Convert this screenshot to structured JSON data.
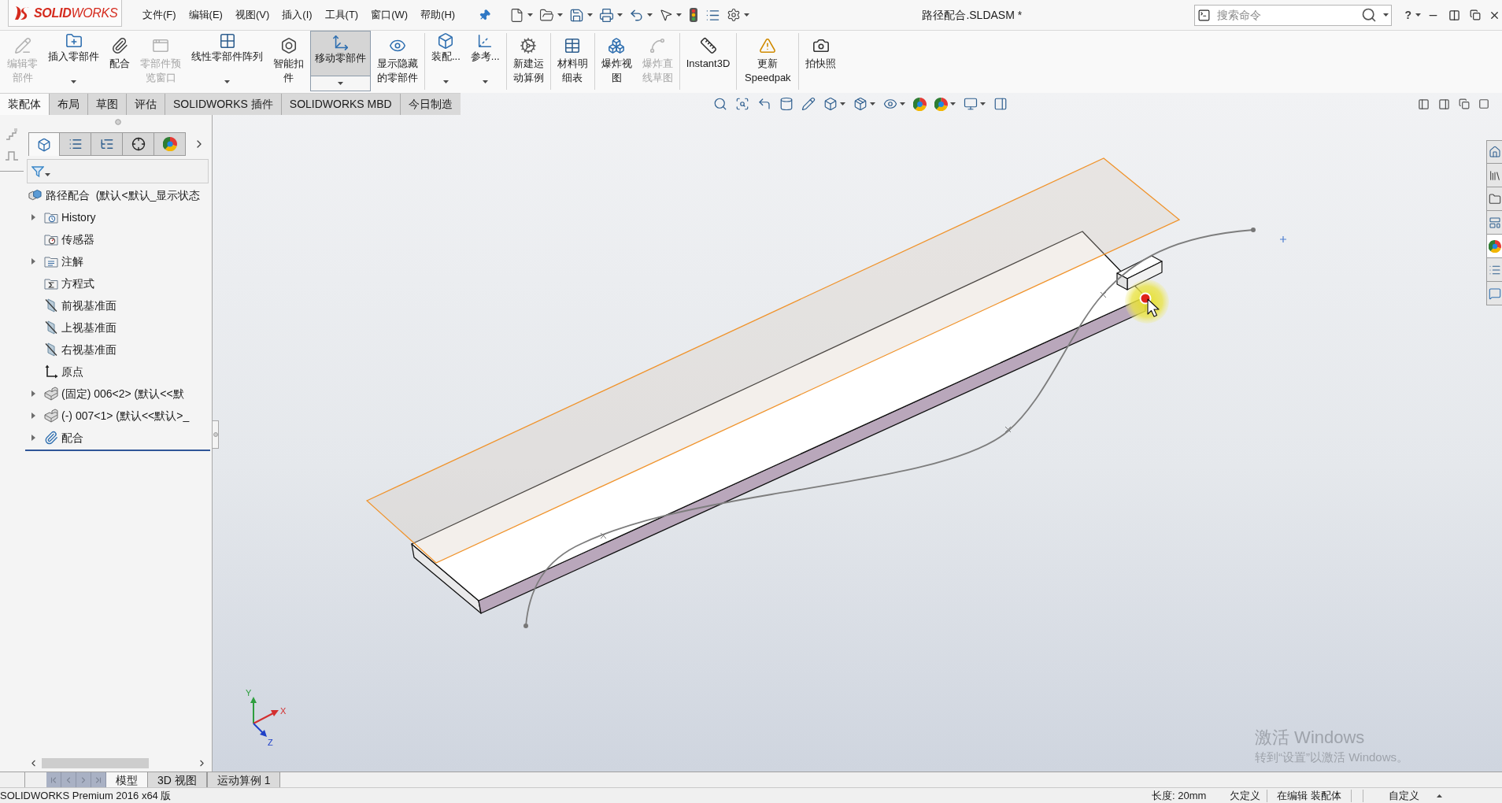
{
  "title_bar": {
    "logo": "**SOLID**WORKS",
    "menu": [
      "文件(F)",
      "编辑(E)",
      "视图(V)",
      "插入(I)",
      "工具(T)",
      "窗口(W)",
      "帮助(H)"
    ],
    "document_title": "路径配合.SLDASM *",
    "search": {
      "placeholder": "搜索命令"
    },
    "help": "?"
  },
  "ribbon": {
    "groups": [
      [
        {
          "label": "编辑零部件",
          "disabled": true,
          "dropdown": false,
          "active": false
        },
        {
          "label": "插入零部件",
          "disabled": false,
          "dropdown": true,
          "active": false
        },
        {
          "label": "配合",
          "disabled": false,
          "dropdown": false,
          "active": false
        },
        {
          "label": "零部件预览窗口",
          "disabled": true,
          "dropdown": false,
          "active": false
        },
        {
          "label": "线性零部件阵列",
          "disabled": false,
          "dropdown": true,
          "active": false
        },
        {
          "label": "智能扣件",
          "disabled": false,
          "dropdown": false,
          "active": false
        },
        {
          "label": "移动零部件",
          "disabled": false,
          "dropdown": true,
          "active": true
        },
        {
          "label": "显示隐藏的零部件",
          "disabled": false,
          "dropdown": false,
          "active": false
        }
      ],
      [
        {
          "label": "装配...",
          "disabled": false,
          "dropdown": true,
          "active": false
        },
        {
          "label": "参考...",
          "disabled": false,
          "dropdown": true,
          "active": false
        }
      ],
      [
        {
          "label": "新建运动算例",
          "disabled": false,
          "dropdown": false,
          "active": false
        }
      ],
      [
        {
          "label": "材料明细表",
          "disabled": false,
          "dropdown": false,
          "active": false
        }
      ],
      [
        {
          "label": "爆炸视图",
          "disabled": false,
          "dropdown": false,
          "active": false
        },
        {
          "label": "爆炸直线草图",
          "disabled": true,
          "dropdown": false,
          "active": false
        }
      ],
      [
        {
          "label": "Instant3D",
          "disabled": false,
          "dropdown": false,
          "active": false
        }
      ],
      [
        {
          "label": "更新 Speedpak",
          "disabled": false,
          "dropdown": false,
          "active": false
        }
      ],
      [
        {
          "label": "拍快照",
          "disabled": false,
          "dropdown": false,
          "active": false
        }
      ]
    ]
  },
  "command_tabs": [
    {
      "label": "装配体",
      "selected": true
    },
    {
      "label": "布局",
      "selected": false
    },
    {
      "label": "草图",
      "selected": false
    },
    {
      "label": "评估",
      "selected": false
    },
    {
      "label": "SOLIDWORKS 插件",
      "selected": false
    },
    {
      "label": "SOLIDWORKS MBD",
      "selected": false
    },
    {
      "label": "今日制造",
      "selected": false
    }
  ],
  "feature_tree": {
    "tabs": [
      {
        "selected": true
      },
      {
        "selected": false
      },
      {
        "selected": false
      },
      {
        "selected": false
      },
      {
        "selected": false
      }
    ],
    "root": "路径配合  (默认<默认_显示状态",
    "items": [
      {
        "kind": "history",
        "label": "History",
        "expandable": true
      },
      {
        "kind": "sensors",
        "label": "传感器",
        "expandable": false
      },
      {
        "kind": "annotations",
        "label": "注解",
        "expandable": true
      },
      {
        "kind": "equations",
        "label": "方程式",
        "expandable": false
      },
      {
        "kind": "plane",
        "label": "前视基准面",
        "expandable": false
      },
      {
        "kind": "plane",
        "label": "上视基准面",
        "expandable": false
      },
      {
        "kind": "plane",
        "label": "右视基准面",
        "expandable": false
      },
      {
        "kind": "origin",
        "label": "原点",
        "expandable": false
      },
      {
        "kind": "part",
        "label": "(固定) 006<2> (默认<<默",
        "expandable": true
      },
      {
        "kind": "part",
        "label": "(-) 007<1> (默认<<默认>_",
        "expandable": true
      },
      {
        "kind": "mates",
        "label": "配合",
        "expandable": true
      }
    ]
  },
  "graphics": {
    "axis_labels": {
      "y": "Y",
      "x": "X",
      "z": "Z"
    },
    "watermark": {
      "title": "激活 Windows",
      "hint": "转到“设置”以激活 Windows。"
    }
  },
  "task_pane": {
    "tabs": [
      {
        "selected": false
      },
      {
        "selected": false
      },
      {
        "selected": false
      },
      {
        "selected": false
      },
      {
        "selected": true
      },
      {
        "selected": false
      },
      {
        "selected": false
      }
    ]
  },
  "sheet_tabs": [
    {
      "label": "模型",
      "selected": true
    },
    {
      "label": "3D 视图",
      "selected": false
    },
    {
      "label": "运动算例 1",
      "selected": false
    }
  ],
  "status_bar": {
    "product": "SOLIDWORKS Premium 2016 x64 版",
    "length": "长度: 20mm",
    "definition": "欠定义",
    "mode": "在编辑 装配体",
    "units": "自定义"
  }
}
